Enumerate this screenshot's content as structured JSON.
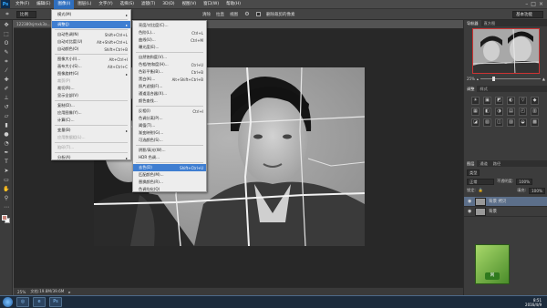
{
  "menubar": {
    "items": [
      "文件(F)",
      "编辑(E)",
      "图像(I)",
      "图层(L)",
      "文字(Y)",
      "选择(S)",
      "滤镜(T)",
      "3D(D)",
      "视图(V)",
      "窗口(W)",
      "帮助(H)"
    ],
    "active_index": 2,
    "app_logo": "Ps"
  },
  "optbar": {
    "mode": "比例",
    "clear_button": "清除",
    "straighten": "拉直",
    "view": "视图",
    "delete_cropped_label": "删除裁剪的像素",
    "workspace": "基本功能"
  },
  "document": {
    "tab_title": "122380sjmxk3a...",
    "zoom": "25%",
    "doc_info": "文档:19.8M/39.6M"
  },
  "image_menu": {
    "items": [
      {
        "label": "模式(M)",
        "shortcut": "",
        "submenu": true,
        "disabled": false
      },
      {
        "separator": true
      },
      {
        "label": "调整(J)",
        "shortcut": "",
        "submenu": true,
        "disabled": false,
        "highlight": true
      },
      {
        "separator": true
      },
      {
        "label": "自动色调(N)",
        "shortcut": "Shift+Ctrl+L",
        "disabled": false
      },
      {
        "label": "自动对比度(U)",
        "shortcut": "Alt+Shift+Ctrl+L",
        "disabled": false
      },
      {
        "label": "自动颜色(O)",
        "shortcut": "Shift+Ctrl+B",
        "disabled": false
      },
      {
        "separator": true
      },
      {
        "label": "图像大小(I)...",
        "shortcut": "Alt+Ctrl+I",
        "disabled": false
      },
      {
        "label": "画布大小(S)...",
        "shortcut": "Alt+Ctrl+C",
        "disabled": false
      },
      {
        "label": "图像旋转(G)",
        "shortcut": "",
        "submenu": true,
        "disabled": false
      },
      {
        "label": "裁剪(P)",
        "shortcut": "",
        "disabled": true
      },
      {
        "label": "裁切(R)...",
        "shortcut": "",
        "disabled": false
      },
      {
        "label": "显示全部(V)",
        "shortcut": "",
        "disabled": false
      },
      {
        "separator": true
      },
      {
        "label": "复制(D)...",
        "shortcut": "",
        "disabled": false
      },
      {
        "label": "应用图像(Y)...",
        "shortcut": "",
        "disabled": false
      },
      {
        "label": "计算(C)...",
        "shortcut": "",
        "disabled": false
      },
      {
        "separator": true
      },
      {
        "label": "变量(B)",
        "shortcut": "",
        "submenu": true,
        "disabled": false
      },
      {
        "label": "应用数据组(L)...",
        "shortcut": "",
        "disabled": true
      },
      {
        "separator": true
      },
      {
        "label": "陷印(T)...",
        "shortcut": "",
        "disabled": true
      },
      {
        "separator": true
      },
      {
        "label": "分析(A)",
        "shortcut": "",
        "submenu": true,
        "disabled": false
      }
    ]
  },
  "adjust_menu": {
    "items": [
      {
        "label": "亮度/对比度(C)...",
        "shortcut": ""
      },
      {
        "label": "色阶(L)...",
        "shortcut": "Ctrl+L"
      },
      {
        "label": "曲线(U)...",
        "shortcut": "Ctrl+M"
      },
      {
        "label": "曝光度(E)...",
        "shortcut": ""
      },
      {
        "separator": true
      },
      {
        "label": "自然饱和度(V)...",
        "shortcut": ""
      },
      {
        "label": "色相/饱和度(H)...",
        "shortcut": "Ctrl+U"
      },
      {
        "label": "色彩平衡(B)...",
        "shortcut": "Ctrl+B"
      },
      {
        "label": "黑白(K)...",
        "shortcut": "Alt+Shift+Ctrl+B"
      },
      {
        "label": "照片滤镜(F)...",
        "shortcut": ""
      },
      {
        "label": "通道混合器(X)...",
        "shortcut": ""
      },
      {
        "label": "颜色查找...",
        "shortcut": ""
      },
      {
        "separator": true
      },
      {
        "label": "反相(I)",
        "shortcut": "Ctrl+I"
      },
      {
        "label": "色调分离(P)...",
        "shortcut": ""
      },
      {
        "label": "阈值(T)...",
        "shortcut": ""
      },
      {
        "label": "渐变映射(G)...",
        "shortcut": ""
      },
      {
        "label": "可选颜色(S)...",
        "shortcut": ""
      },
      {
        "separator": true
      },
      {
        "label": "阴影/高光(W)...",
        "shortcut": ""
      },
      {
        "label": "HDR 色调...",
        "shortcut": ""
      },
      {
        "separator": true
      },
      {
        "label": "去色(D)",
        "shortcut": "Shift+Ctrl+U",
        "highlight": true
      },
      {
        "label": "匹配颜色(M)...",
        "shortcut": ""
      },
      {
        "label": "替换颜色(R)...",
        "shortcut": ""
      },
      {
        "label": "色调均化(Q)",
        "shortcut": ""
      }
    ]
  },
  "navigator": {
    "tabs": [
      "导航器",
      "直方图"
    ],
    "zoom": "25%"
  },
  "adjustments": {
    "tabs": [
      "调整",
      "样式"
    ],
    "icons": [
      "☀",
      "▣",
      "◩",
      "◐",
      "▽",
      "◆",
      "▦",
      "◧",
      "◑",
      "▤",
      "◰",
      "▥",
      "◪",
      "▧",
      "◫",
      "▨",
      "◒",
      "▩"
    ]
  },
  "layers": {
    "tabs": [
      "图层",
      "通道",
      "路径"
    ],
    "filter_kind": "类型",
    "blend_mode": "正常",
    "opacity_label": "不透明度:",
    "opacity_value": "100%",
    "lock_label": "锁定:",
    "fill_label": "填充:",
    "fill_value": "100%",
    "list": [
      {
        "name": "背景 拷贝",
        "selected": true
      },
      {
        "name": "背景",
        "selected": false
      }
    ]
  },
  "ad": {
    "label": "网"
  },
  "taskbar": {
    "time": "8:51",
    "date": "2016/4/9",
    "apps": [
      "◎",
      "e",
      "Ps"
    ]
  }
}
